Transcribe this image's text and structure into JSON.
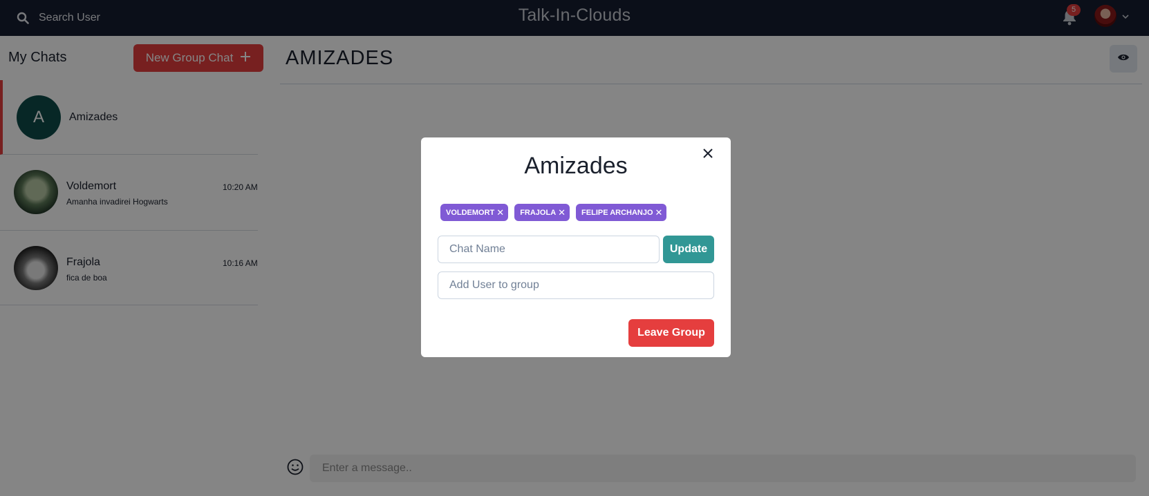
{
  "header": {
    "search_label": "Search User",
    "app_title": "Talk-In-Clouds",
    "notification_count": "5"
  },
  "sidebar": {
    "title": "My Chats",
    "new_group_label": "New Group Chat",
    "chats": [
      {
        "name": "Amizades",
        "avatar_letter": "A",
        "time": "",
        "last_message": "",
        "active": true
      },
      {
        "name": "Voldemort",
        "time": "10:20 AM",
        "last_message": "Amanha invadirei Hogwarts"
      },
      {
        "name": "Frajola",
        "time": "10:16 AM",
        "last_message": "fica de boa"
      }
    ]
  },
  "main": {
    "chat_title": "AMIZADES",
    "message_placeholder": "Enter a message.."
  },
  "modal": {
    "title": "Amizades",
    "members": [
      "VOLDEMORT",
      "FRAJOLA",
      "FELIPE ARCHANJO"
    ],
    "chat_name_placeholder": "Chat Name",
    "update_label": "Update",
    "add_user_placeholder": "Add User to group",
    "leave_label": "Leave Group"
  },
  "colors": {
    "topbar": "#161d31",
    "accent_red": "#e53e3e",
    "tag_purple": "#805ad5",
    "update_teal": "#319795",
    "avatar_teal": "#0f4c4a"
  }
}
